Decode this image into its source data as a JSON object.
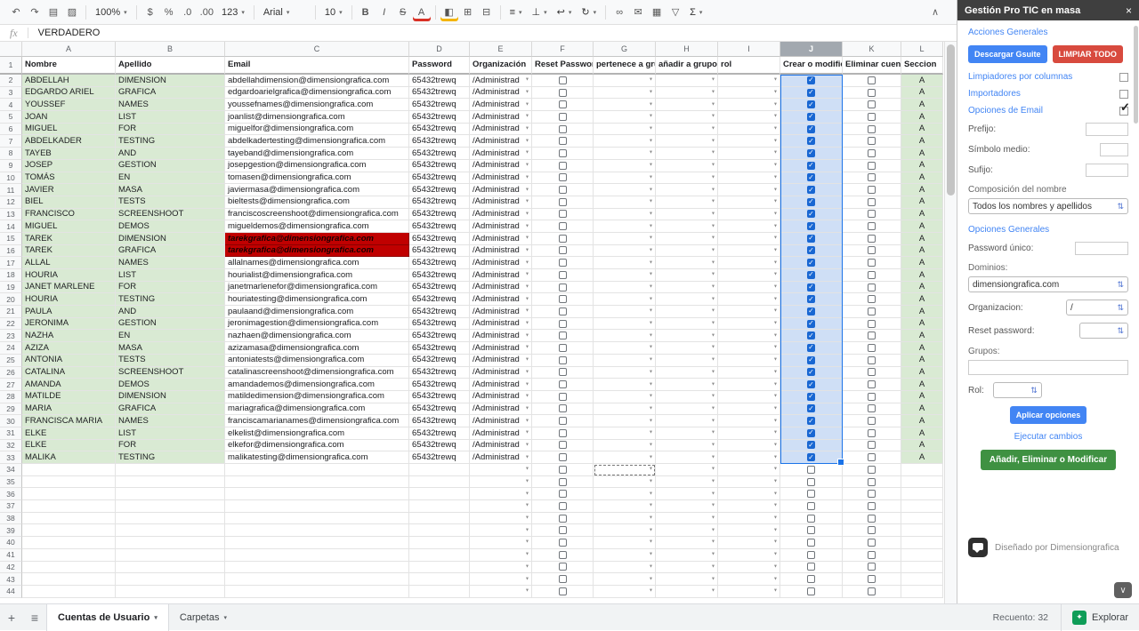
{
  "icons": {
    "close": "×",
    "check": "✓",
    "dropdown": "▼",
    "select_arrow": "▾",
    "stepper": "⇅",
    "chevron_down": "∨",
    "plus": "+",
    "menu": "≡",
    "explore": "✦"
  },
  "toolbar": {
    "items": [
      {
        "type": "icon",
        "name": "undo-icon",
        "glyph": "↶"
      },
      {
        "type": "icon",
        "name": "redo-icon",
        "glyph": "↷"
      },
      {
        "type": "icon",
        "name": "print-icon",
        "glyph": "▤"
      },
      {
        "type": "icon",
        "name": "paint-format-icon",
        "glyph": "▨"
      },
      {
        "type": "divider"
      },
      {
        "type": "select",
        "name": "zoom-select",
        "label": "100%"
      },
      {
        "type": "divider"
      },
      {
        "type": "icon",
        "name": "format-currency-icon",
        "glyph": "$"
      },
      {
        "type": "icon",
        "name": "format-percent-icon",
        "glyph": "%"
      },
      {
        "type": "icon",
        "name": "decrease-decimal-icon",
        "glyph": ".0"
      },
      {
        "type": "icon",
        "name": "increase-decimal-icon",
        "glyph": ".00"
      },
      {
        "type": "select",
        "name": "number-format-menu",
        "label": "123"
      },
      {
        "type": "divider"
      },
      {
        "type": "select",
        "name": "font-family-select",
        "label": "Arial",
        "wide": true
      },
      {
        "type": "divider"
      },
      {
        "type": "select",
        "name": "font-size-select",
        "label": "10"
      },
      {
        "type": "divider"
      },
      {
        "type": "icon",
        "name": "bold-icon",
        "glyph": "B",
        "bold": true
      },
      {
        "type": "icon",
        "name": "italic-icon",
        "glyph": "I",
        "italic": true
      },
      {
        "type": "icon",
        "name": "strikethrough-icon",
        "glyph": "S",
        "strike": true
      },
      {
        "type": "icon",
        "name": "text-color-icon",
        "glyph": "A",
        "bar": "#d93025"
      },
      {
        "type": "divider"
      },
      {
        "type": "icon",
        "name": "fill-color-icon",
        "glyph": "◧",
        "bar": "#f4b400"
      },
      {
        "type": "icon",
        "name": "borders-icon",
        "glyph": "⊞"
      },
      {
        "type": "icon",
        "name": "merge-cells-icon",
        "glyph": "⊟"
      },
      {
        "type": "divider"
      },
      {
        "type": "select",
        "name": "horizontal-align-menu",
        "glyph": "≡"
      },
      {
        "type": "select",
        "name": "vertical-align-menu",
        "glyph": "⊥"
      },
      {
        "type": "select",
        "name": "text-wrap-menu",
        "glyph": "↩"
      },
      {
        "type": "select",
        "name": "text-rotation-menu",
        "glyph": "↻"
      },
      {
        "type": "divider"
      },
      {
        "type": "icon",
        "name": "insert-link-icon",
        "glyph": "∞"
      },
      {
        "type": "icon",
        "name": "insert-comment-icon",
        "glyph": "✉"
      },
      {
        "type": "icon",
        "name": "insert-chart-icon",
        "glyph": "▦"
      },
      {
        "type": "icon",
        "name": "filter-icon",
        "glyph": "▽"
      },
      {
        "type": "select",
        "name": "functions-menu",
        "glyph": "Σ"
      },
      {
        "type": "icon",
        "name": "collapse-toolbar-icon",
        "glyph": "∧"
      }
    ]
  },
  "formula_bar": {
    "fx": "fx",
    "value": "VERDADERO"
  },
  "sheet": {
    "column_letters": [
      "A",
      "B",
      "C",
      "D",
      "E",
      "F",
      "G",
      "H",
      "I",
      "J",
      "K",
      "L"
    ],
    "selected_column": "J",
    "selected_range": "J2:J33",
    "copy_source_row": 34,
    "headers": [
      "Nombre",
      "Apellido",
      "Email",
      "Password",
      "Organización",
      "Reset Passwor",
      "pertenece a gru",
      "añadir a grupos",
      "rol",
      "Crear o modific",
      "Eliminar cuent",
      "Seccion"
    ],
    "shared": {
      "password": "65432trewq",
      "organizacion": "/Administrad",
      "seccion": "A"
    },
    "checkbox_states": {
      "reset_password": false,
      "crear_o_modificar": true,
      "eliminar_cuenta": false
    },
    "colors": {
      "row_green": "#d9ead3",
      "highlight_red": "#c00000",
      "selection_blue": "#1a73e8",
      "checkbox_blue": "#1967d2"
    },
    "rows": [
      {
        "row": 2,
        "nombre": "ABDELLAH",
        "apellido": "DIMENSION",
        "email": "abdellahdimension@dimensiongrafica.com"
      },
      {
        "row": 3,
        "nombre": "EDGARDO ARIEL",
        "apellido": "GRAFICA",
        "email": "edgardoarielgrafica@dimensiongrafica.com"
      },
      {
        "row": 4,
        "nombre": "YOUSSEF",
        "apellido": "NAMES",
        "email": "youssefnames@dimensiongrafica.com"
      },
      {
        "row": 5,
        "nombre": "JOAN",
        "apellido": "LIST",
        "email": "joanlist@dimensiongrafica.com"
      },
      {
        "row": 6,
        "nombre": "MIGUEL",
        "apellido": "FOR",
        "email": "miguelfor@dimensiongrafica.com"
      },
      {
        "row": 7,
        "nombre": "ABDELKADER",
        "apellido": "TESTING",
        "email": "abdelkadertesting@dimensiongrafica.com"
      },
      {
        "row": 8,
        "nombre": "TAYEB",
        "apellido": "AND",
        "email": "tayeband@dimensiongrafica.com"
      },
      {
        "row": 9,
        "nombre": "JOSEP",
        "apellido": "GESTION",
        "email": "josepgestion@dimensiongrafica.com"
      },
      {
        "row": 10,
        "nombre": "TOMÁS",
        "apellido": "EN",
        "email": "tomasen@dimensiongrafica.com"
      },
      {
        "row": 11,
        "nombre": "JAVIER",
        "apellido": "MASA",
        "email": "javiermasa@dimensiongrafica.com"
      },
      {
        "row": 12,
        "nombre": "BIEL",
        "apellido": "TESTS",
        "email": "bieltests@dimensiongrafica.com"
      },
      {
        "row": 13,
        "nombre": "FRANCISCO",
        "apellido": "SCREENSHOOT",
        "email": "franciscoscreenshoot@dimensiongrafica.com"
      },
      {
        "row": 14,
        "nombre": "MIGUEL",
        "apellido": "DEMOS",
        "email": "migueldemos@dimensiongrafica.com"
      },
      {
        "row": 15,
        "nombre": "TAREK",
        "apellido": "DIMENSION",
        "email": "tarekgrafica@dimensiongrafica.com",
        "highlight": true
      },
      {
        "row": 16,
        "nombre": "TAREK",
        "apellido": "GRAFICA",
        "email": "tarekgrafica@dimensiongrafica.com",
        "highlight": true
      },
      {
        "row": 17,
        "nombre": "ALLAL",
        "apellido": "NAMES",
        "email": "allalnames@dimensiongrafica.com"
      },
      {
        "row": 18,
        "nombre": "HOURIA",
        "apellido": "LIST",
        "email": "hourialist@dimensiongrafica.com"
      },
      {
        "row": 19,
        "nombre": "JANET MARLENE",
        "apellido": "FOR",
        "email": "janetmarlenefor@dimensiongrafica.com"
      },
      {
        "row": 20,
        "nombre": "HOURIA",
        "apellido": "TESTING",
        "email": "houriatesting@dimensiongrafica.com"
      },
      {
        "row": 21,
        "nombre": "PAULA",
        "apellido": "AND",
        "email": "paulaand@dimensiongrafica.com"
      },
      {
        "row": 22,
        "nombre": "JERONIMA",
        "apellido": "GESTION",
        "email": "jeronimagestion@dimensiongrafica.com"
      },
      {
        "row": 23,
        "nombre": "NAZHA",
        "apellido": "EN",
        "email": "nazhaen@dimensiongrafica.com"
      },
      {
        "row": 24,
        "nombre": "AZIZA",
        "apellido": "MASA",
        "email": "azizamasa@dimensiongrafica.com"
      },
      {
        "row": 25,
        "nombre": "ANTONIA",
        "apellido": "TESTS",
        "email": "antoniatests@dimensiongrafica.com"
      },
      {
        "row": 26,
        "nombre": "CATALINA",
        "apellido": "SCREENSHOOT",
        "email": "catalinascreenshoot@dimensiongrafica.com"
      },
      {
        "row": 27,
        "nombre": "AMANDA",
        "apellido": "DEMOS",
        "email": "amandademos@dimensiongrafica.com"
      },
      {
        "row": 28,
        "nombre": "MATILDE",
        "apellido": "DIMENSION",
        "email": "matildedimension@dimensiongrafica.com"
      },
      {
        "row": 29,
        "nombre": "MARIA",
        "apellido": "GRAFICA",
        "email": "mariagrafica@dimensiongrafica.com"
      },
      {
        "row": 30,
        "nombre": "FRANCISCA MARIA",
        "apellido": "NAMES",
        "email": "franciscamarianames@dimensiongrafica.com"
      },
      {
        "row": 31,
        "nombre": "ELKE",
        "apellido": "LIST",
        "email": "elkelist@dimensiongrafica.com"
      },
      {
        "row": 32,
        "nombre": "ELKE",
        "apellido": "FOR",
        "email": "elkefor@dimensiongrafica.com"
      },
      {
        "row": 33,
        "nombre": "MALIKA",
        "apellido": "TESTING",
        "email": "malikatesting@dimensiongrafica.com"
      }
    ],
    "empty_rows": [
      34,
      35,
      36,
      37,
      38,
      39,
      40,
      41,
      42,
      43,
      44
    ]
  },
  "sidebar": {
    "title": "Gestión Pro TIC en masa",
    "acciones_generales": "Acciones Generales",
    "descargar": "Descargar Gsuite",
    "limpiar": "LIMPIAR TODO",
    "limpiadores": "Limpiadores por columnas",
    "importadores": "Importadores",
    "opciones_email": "Opciones de Email",
    "prefijo": "Prefijo:",
    "simbolo": "Símbolo medio:",
    "sufijo": "Sufijo:",
    "composicion": "Composición del nombre",
    "composicion_value": "Todos los nombres y apellidos",
    "opciones_generales": "Opciones Generales",
    "password_unico": "Password único:",
    "dominios": "Dominios:",
    "dominios_value": "dimensiongrafica.com",
    "organizacion": "Organizacion:",
    "organizacion_value": "/",
    "reset_password": "Reset password:",
    "grupos": "Grupos:",
    "rol": "Rol:",
    "aplicar": "Aplicar opciones",
    "ejecutar": "Ejecutar cambios",
    "anadir": "Añadir, Eliminar o Modificar",
    "footer": "Diseñado por Dimensiongrafica"
  },
  "bottom_bar": {
    "tab1": "Cuentas de Usuario",
    "tab2": "Carpetas",
    "recuento": "Recuento: 32",
    "explorar": "Explorar"
  }
}
